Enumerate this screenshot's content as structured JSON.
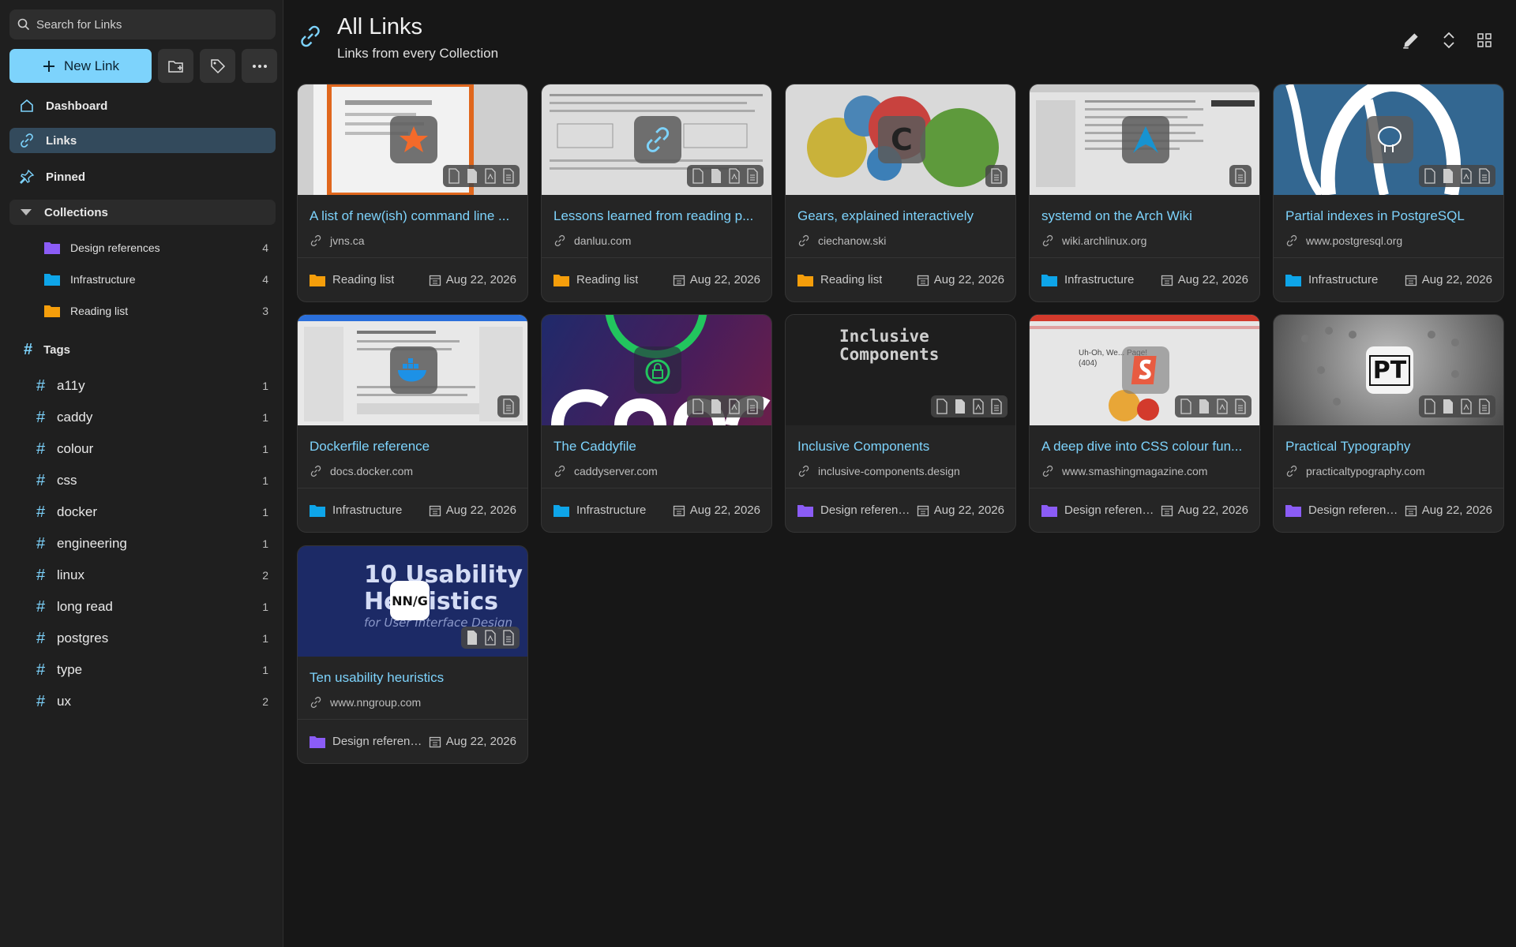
{
  "search": {
    "placeholder": "Search for Links"
  },
  "sidebar": {
    "new_link_label": "New Link",
    "nav": [
      {
        "label": "Dashboard"
      },
      {
        "label": "Links"
      },
      {
        "label": "Pinned"
      }
    ],
    "collections_label": "Collections",
    "collections": [
      {
        "label": "Design references",
        "count": "4",
        "color": "#8b5cf6"
      },
      {
        "label": "Infrastructure",
        "count": "4",
        "color": "#0ea5e9"
      },
      {
        "label": "Reading list",
        "count": "3",
        "color": "#f59e0b"
      }
    ],
    "tags_label": "Tags",
    "tags": [
      {
        "label": "a11y",
        "count": "1"
      },
      {
        "label": "caddy",
        "count": "1"
      },
      {
        "label": "colour",
        "count": "1"
      },
      {
        "label": "css",
        "count": "1"
      },
      {
        "label": "docker",
        "count": "1"
      },
      {
        "label": "engineering",
        "count": "1"
      },
      {
        "label": "linux",
        "count": "2"
      },
      {
        "label": "long read",
        "count": "1"
      },
      {
        "label": "postgres",
        "count": "1"
      },
      {
        "label": "type",
        "count": "1"
      },
      {
        "label": "ux",
        "count": "2"
      }
    ]
  },
  "header": {
    "title": "All Links",
    "subtitle": "Links from every Collection"
  },
  "cards": [
    {
      "title": "A list of new(ish) command line ...",
      "url": "jvns.ca",
      "collection": "Reading list",
      "date": "Aug 22, 2026"
    },
    {
      "title": "Lessons learned from reading p...",
      "url": "danluu.com",
      "collection": "Reading list",
      "date": "Aug 22, 2026"
    },
    {
      "title": "Gears, explained interactively",
      "url": "ciechanow.ski",
      "collection": "Reading list",
      "date": "Aug 22, 2026"
    },
    {
      "title": "systemd on the Arch Wiki",
      "url": "wiki.archlinux.org",
      "collection": "Infrastructure",
      "date": "Aug 22, 2026"
    },
    {
      "title": "Partial indexes in PostgreSQL",
      "url": "www.postgresql.org",
      "collection": "Infrastructure",
      "date": "Aug 22, 2026"
    },
    {
      "title": "Dockerfile reference",
      "url": "docs.docker.com",
      "collection": "Infrastructure",
      "date": "Aug 22, 2026"
    },
    {
      "title": "The Caddyfile",
      "url": "caddyserver.com",
      "collection": "Infrastructure",
      "date": "Aug 22, 2026"
    },
    {
      "title": "Inclusive Components",
      "url": "inclusive-components.design",
      "collection": "Design referenc...",
      "date": "Aug 22, 2026",
      "thumb_text": [
        "Inclusive",
        "Components"
      ]
    },
    {
      "title": "A deep dive into CSS colour fun...",
      "url": "www.smashingmagazine.com",
      "collection": "Design referenc...",
      "date": "Aug 22, 2026",
      "thumb_text": [
        "Uh-Oh, We... Page!",
        "(404)"
      ]
    },
    {
      "title": "Practical Typography",
      "url": "practicaltypography.com",
      "collection": "Design referenc...",
      "date": "Aug 22, 2026",
      "fav_text": "PT"
    },
    {
      "title": "Ten usability heuristics",
      "url": "www.nngroup.com",
      "collection": "Design referenc...",
      "date": "Aug 22, 2026",
      "thumb_text": [
        "10 Usability",
        "Heuristics",
        "for User Interface Design"
      ],
      "fav_text": "NN/G"
    }
  ],
  "colors": {
    "accent": "#7dd3fc",
    "reading_list": "#f59e0b",
    "infrastructure": "#0ea5e9",
    "design_references": "#8b5cf6"
  }
}
